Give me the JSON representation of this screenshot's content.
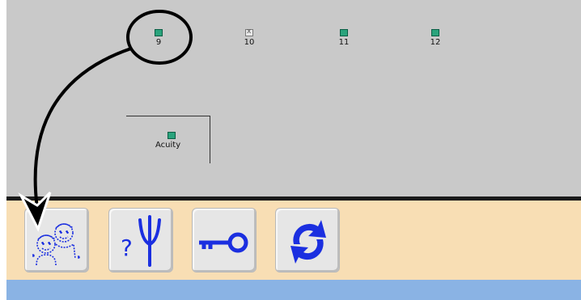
{
  "beds": [
    {
      "label": "9",
      "status": "occupied"
    },
    {
      "label": "10",
      "status": "empty"
    },
    {
      "label": "11",
      "status": "occupied"
    },
    {
      "label": "12",
      "status": "occupied"
    }
  ],
  "acuity": {
    "label": "Acuity"
  },
  "toolbar": {
    "buttons": [
      {
        "icon": "patient-group-icon"
      },
      {
        "icon": "help-antenna-icon",
        "glyph": "?"
      },
      {
        "icon": "key-icon"
      },
      {
        "icon": "refresh-icon"
      }
    ]
  },
  "colors": {
    "panel": "#c9c9c9",
    "toolbar": "#f8deb4",
    "bottom_bar": "#8ab3e4",
    "icon_blue": "#1b2fe0",
    "bed_green": "#2aa37c"
  }
}
